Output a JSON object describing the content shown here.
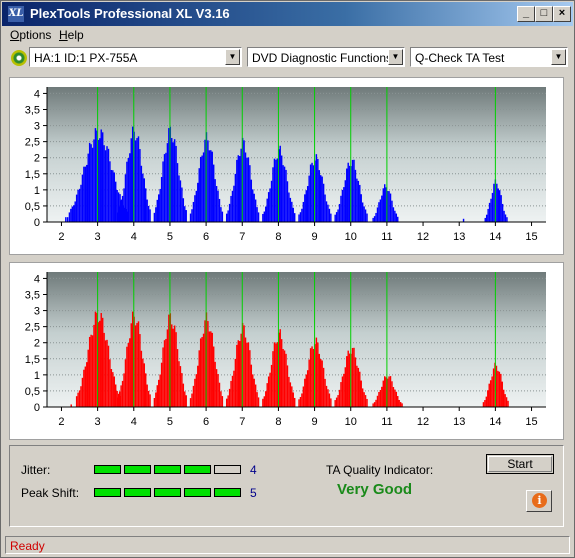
{
  "window": {
    "title": "PlexTools Professional XL V3.16",
    "icon_text": "XL",
    "controls": [
      "_",
      "□",
      "×"
    ]
  },
  "menu": {
    "items": [
      {
        "label": "Options",
        "accel": "O",
        "rest": "ptions"
      },
      {
        "label": "Help",
        "accel": "H",
        "rest": "elp"
      }
    ]
  },
  "toolbar": {
    "drive": "HA:1 ID:1  PX-755A",
    "function": "DVD Diagnostic Functions",
    "test": "Q-Check TA Test"
  },
  "chart_data": [
    {
      "type": "bar",
      "name": "upper",
      "color": "#0000ff",
      "xlim": [
        1.6,
        15.4
      ],
      "ylim": [
        0,
        4.2
      ],
      "xticks": [
        2,
        3,
        4,
        5,
        6,
        7,
        8,
        9,
        10,
        11,
        12,
        13,
        14,
        15
      ],
      "yticks": [
        0,
        0.5,
        1,
        1.5,
        2,
        2.5,
        3,
        3.5,
        4
      ],
      "ytick_labels": [
        "0",
        "0,5",
        "1",
        "1,5",
        "2",
        "2,5",
        "3",
        "3,5",
        "4"
      ],
      "marker_lines": [
        3,
        4,
        5,
        6,
        7,
        8,
        9,
        10,
        11,
        14
      ],
      "peaks": [
        {
          "center": 3.0,
          "height": 3.0,
          "halfwidth": 0.8
        },
        {
          "center": 4.0,
          "height": 3.05,
          "halfwidth": 0.45
        },
        {
          "center": 5.0,
          "height": 3.05,
          "halfwidth": 0.45
        },
        {
          "center": 6.0,
          "height": 2.8,
          "halfwidth": 0.45
        },
        {
          "center": 7.0,
          "height": 2.65,
          "halfwidth": 0.45
        },
        {
          "center": 8.0,
          "height": 2.4,
          "halfwidth": 0.45
        },
        {
          "center": 9.0,
          "height": 2.15,
          "halfwidth": 0.45
        },
        {
          "center": 10.0,
          "height": 2.05,
          "halfwidth": 0.45
        },
        {
          "center": 10.95,
          "height": 1.2,
          "halfwidth": 0.35
        },
        {
          "center": 14.0,
          "height": 1.35,
          "halfwidth": 0.3
        }
      ],
      "extra_bars": [
        [
          2.1,
          0.15
        ],
        [
          2.15,
          0.15
        ],
        [
          13.1,
          0.1
        ]
      ]
    },
    {
      "type": "bar",
      "name": "lower",
      "color": "#ff0000",
      "xlim": [
        1.6,
        15.4
      ],
      "ylim": [
        0,
        4.2
      ],
      "xticks": [
        2,
        3,
        4,
        5,
        6,
        7,
        8,
        9,
        10,
        11,
        12,
        13,
        14,
        15
      ],
      "yticks": [
        0,
        0.5,
        1,
        1.5,
        2,
        2.5,
        3,
        3.5,
        4
      ],
      "ytick_labels": [
        "0",
        "0,5",
        "1",
        "1,5",
        "2",
        "2,5",
        "3",
        "3,5",
        "4"
      ],
      "marker_lines": [
        3,
        4,
        5,
        6,
        7,
        8,
        9,
        10,
        11,
        14
      ],
      "peaks": [
        {
          "center": 3.0,
          "height": 3.1,
          "halfwidth": 0.6
        },
        {
          "center": 4.0,
          "height": 3.05,
          "halfwidth": 0.45
        },
        {
          "center": 5.0,
          "height": 3.0,
          "halfwidth": 0.45
        },
        {
          "center": 6.0,
          "height": 2.95,
          "halfwidth": 0.45
        },
        {
          "center": 7.0,
          "height": 2.65,
          "halfwidth": 0.45
        },
        {
          "center": 8.0,
          "height": 2.45,
          "halfwidth": 0.45
        },
        {
          "center": 9.0,
          "height": 2.2,
          "halfwidth": 0.45
        },
        {
          "center": 10.0,
          "height": 1.95,
          "halfwidth": 0.45
        },
        {
          "center": 11.0,
          "height": 1.05,
          "halfwidth": 0.4
        },
        {
          "center": 14.0,
          "height": 1.4,
          "halfwidth": 0.35
        }
      ],
      "extra_bars": [
        [
          2.25,
          0.08
        ]
      ]
    }
  ],
  "metrics": {
    "jitter": {
      "label": "Jitter:",
      "value": "4",
      "filled": 4,
      "total": 5
    },
    "peak_shift": {
      "label": "Peak Shift:",
      "value": "5",
      "filled": 5,
      "total": 5
    },
    "ta_quality": {
      "label": "TA Quality Indicator:",
      "value": "Very Good",
      "color": "#1a8a1a"
    }
  },
  "buttons": {
    "start": "Start",
    "info_icon": "info-icon"
  },
  "status": {
    "text": "Ready",
    "color": "#d00000"
  }
}
